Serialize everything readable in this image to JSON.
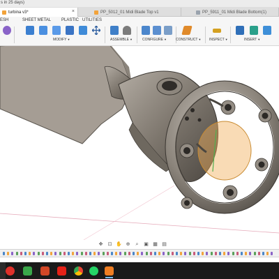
{
  "trial_notice": "s in 25 days)",
  "doc_tabs": [
    {
      "label": "turbina v3*",
      "color": "#f2a33a"
    },
    {
      "label": "PP_5012_01 Midi Blade Top v1",
      "color": "#f2a33a"
    },
    {
      "label": "PP_5911_01 Midi Blade Bottom(1)",
      "color": "#9aa3ad"
    }
  ],
  "tab_close": "×",
  "workspace_tabs": [
    "ESH",
    "SHEET METAL",
    "PLASTIC",
    "UTILITIES"
  ],
  "toolbar_groups": [
    {
      "label": "MODIFY",
      "icons": [
        {
          "name": "surface-icon",
          "color": "#8a63c8"
        },
        {
          "name": "press-pull-icon",
          "color": "#3b7fd0"
        },
        {
          "name": "fillet-icon",
          "color": "#4a8fe0"
        },
        {
          "name": "chamfer-icon",
          "color": "#5a9ae8"
        },
        {
          "name": "shell-icon",
          "color": "#3a74c4"
        },
        {
          "name": "move-copy-icon",
          "color": "#2f5fa0"
        }
      ]
    },
    {
      "label": "ASSEMBLE",
      "icons": [
        {
          "name": "new-component-icon",
          "color": "#3f7fc8"
        },
        {
          "name": "joint-icon",
          "color": "#6c6c6c"
        }
      ]
    },
    {
      "label": "CONFIGURE",
      "icons": [
        {
          "name": "parameters-icon",
          "color": "#4b86cc"
        },
        {
          "name": "configure-table-icon",
          "color": "#5b8fd0"
        },
        {
          "name": "properties-icon",
          "color": "#7a9ec8"
        }
      ]
    },
    {
      "label": "CONSTRUCT",
      "icons": [
        {
          "name": "offset-plane-icon",
          "color": "#e08a2a"
        }
      ]
    },
    {
      "label": "INSPECT",
      "icons": [
        {
          "name": "measure-icon",
          "color": "#d4a021"
        }
      ]
    },
    {
      "label": "INSERT",
      "icons": [
        {
          "name": "insert-derive-icon",
          "color": "#2f6fb8"
        },
        {
          "name": "insert-mesh-icon",
          "color": "#2aa08a"
        },
        {
          "name": "insert-canvas-icon",
          "color": "#3e8fd8"
        }
      ]
    }
  ],
  "nav_icons": [
    "orbit-icon",
    "pan-icon",
    "look-at-icon",
    "zoom-icon",
    "fit-icon",
    "display-settings-icon",
    "grid-icon",
    "viewports-icon"
  ],
  "nav_glyphs": [
    "✥",
    "⊡",
    "✋",
    "⊕",
    "⌕",
    "▣",
    "▦",
    "▤"
  ],
  "timeline_steps": 63,
  "taskbar_apps": [
    {
      "name": "opera-icon",
      "color": "#e0302a"
    },
    {
      "name": "antivirus-icon",
      "color": "#3aa64a"
    },
    {
      "name": "powerpoint-icon",
      "color": "#d24726"
    },
    {
      "name": "youtube-icon",
      "color": "#e62117"
    },
    {
      "name": "chrome-icon",
      "color": "#4a8ef0"
    },
    {
      "name": "whatsapp-icon",
      "color": "#25d366"
    },
    {
      "name": "fusion-icon",
      "color": "#f07e23"
    }
  ],
  "colors": {
    "model_metal": "#8a8278",
    "blade_fill": "#a79f96",
    "selection_highlight": "#f2b05a",
    "taskbar": "#1a1a1a"
  }
}
